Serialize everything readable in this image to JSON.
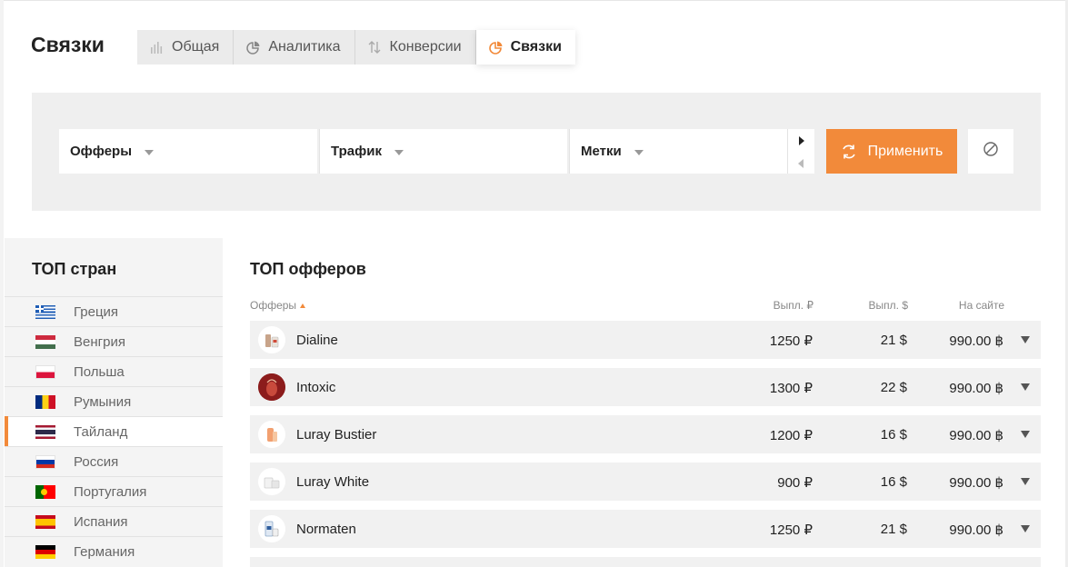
{
  "page": {
    "title": "Связки"
  },
  "tabs": [
    {
      "label": "Общая",
      "icon": "bar-chart-icon",
      "active": false
    },
    {
      "label": "Аналитика",
      "icon": "pie-chart-icon",
      "active": false
    },
    {
      "label": "Конверсии",
      "icon": "swap-vertical-icon",
      "active": false
    },
    {
      "label": "Связки",
      "icon": "pie-chart-orange-icon",
      "active": true
    }
  ],
  "filters": {
    "offers_label": "Офферы",
    "traffic_label": "Трафик",
    "tags_label": "Метки",
    "apply_label": "Применить"
  },
  "countries": {
    "title": "ТОП стран",
    "items": [
      {
        "name": "Греция",
        "flag": "greece-flag-icon"
      },
      {
        "name": "Венгрия",
        "flag": "hungary-flag-icon"
      },
      {
        "name": "Польша",
        "flag": "poland-flag-icon"
      },
      {
        "name": "Румыния",
        "flag": "romania-flag-icon"
      },
      {
        "name": "Тайланд",
        "flag": "thailand-flag-icon",
        "active": true
      },
      {
        "name": "Россия",
        "flag": "russia-flag-icon"
      },
      {
        "name": "Португалия",
        "flag": "portugal-flag-icon"
      },
      {
        "name": "Испания",
        "flag": "spain-flag-icon"
      },
      {
        "name": "Германия",
        "flag": "germany-flag-icon"
      }
    ]
  },
  "offers": {
    "title": "ТОП офферов",
    "headers": {
      "name": "Офферы",
      "rub": "Выпл. ₽",
      "usd": "Выпл. $",
      "site": "На сайте"
    },
    "rows": [
      {
        "name": "Dialine",
        "rub": "1250 ₽",
        "usd": "21 $",
        "site": "990.00 ฿"
      },
      {
        "name": "Intoxic",
        "rub": "1300 ₽",
        "usd": "22 $",
        "site": "990.00 ฿"
      },
      {
        "name": "Luray Bustier",
        "rub": "1200 ₽",
        "usd": "16 $",
        "site": "990.00 ฿"
      },
      {
        "name": "Luray White",
        "rub": "900 ₽",
        "usd": "16 $",
        "site": "990.00 ฿"
      },
      {
        "name": "Normaten",
        "rub": "1250 ₽",
        "usd": "21 $",
        "site": "990.00 ฿"
      }
    ]
  },
  "colors": {
    "accent": "#f28a3a",
    "panel": "#efefef",
    "row": "#f1f1f1"
  }
}
